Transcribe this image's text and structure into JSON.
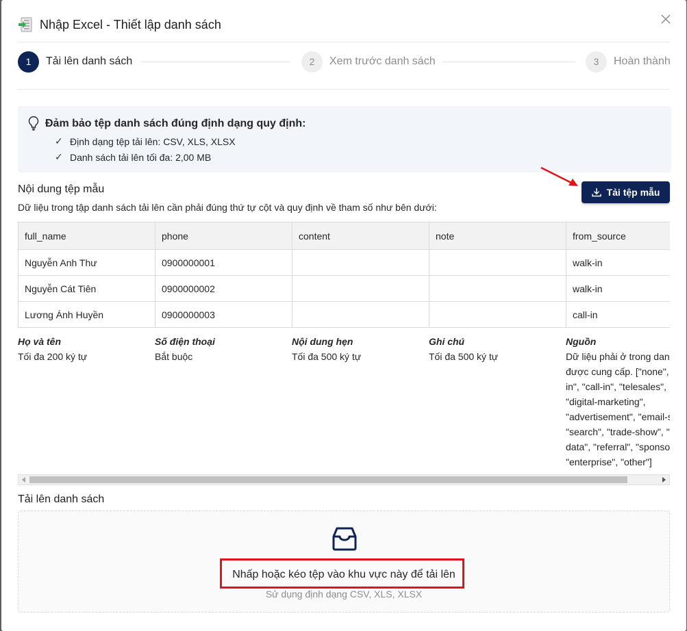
{
  "dialog": {
    "title": "Nhập Excel - Thiết lập danh sách",
    "close_icon": "close-icon",
    "title_icon": "excel-import-icon"
  },
  "steps": [
    {
      "number": "1",
      "label": "Tải lên danh sách",
      "state": "active"
    },
    {
      "number": "2",
      "label": "Xem trước danh sách",
      "state": "inactive"
    },
    {
      "number": "3",
      "label": "Hoàn thành",
      "state": "inactive"
    }
  ],
  "notice": {
    "icon": "lightbulb-icon",
    "title": "Đảm bảo tệp danh sách đúng định dạng quy định:",
    "items": [
      "Định dạng tệp tải lên:  CSV, XLS, XLSX",
      "Danh sách tải lên tối đa:  2,00 MB"
    ]
  },
  "template": {
    "title": "Nội dung tệp mẫu",
    "description": "Dữ liệu trong tập danh sách tải lên cần phải đúng thứ tự cột và quy định về tham số như bên dưới:",
    "download_label": "Tải tệp mẫu",
    "columns": [
      "full_name",
      "phone",
      "content",
      "note",
      "from_source"
    ],
    "rows": [
      [
        "Nguyễn Anh Thư",
        "0900000001",
        "",
        "",
        "walk-in"
      ],
      [
        "Nguyễn Cát Tiên",
        "0900000002",
        "",
        "",
        "walk-in"
      ],
      [
        "Lương Ánh Huyền",
        "0900000003",
        "",
        "",
        "call-in"
      ]
    ],
    "meta": [
      {
        "title": "Họ và tên",
        "lines": [
          "Tối đa 200 ký tự"
        ]
      },
      {
        "title": "Số điện thoại",
        "lines": [
          "Bắt buộc"
        ]
      },
      {
        "title": "Nội dung hẹn",
        "lines": [
          "Tối đa 500 ký tự"
        ]
      },
      {
        "title": "Ghi chú",
        "lines": [
          "Tối đa 500 ký tự"
        ]
      },
      {
        "title": "Nguồn",
        "lines": [
          "Dữ liệu phải ở trong dan",
          "được cung cấp. [\"none\",",
          "in\", \"call-in\", \"telesales\",",
          "\"digital-marketing\",",
          "\"advertisement\", \"email-s",
          "\"search\", \"trade-show\", \"",
          "data\", \"referral\", \"sponso",
          "\"enterprise\", \"other\"]"
        ]
      }
    ]
  },
  "upload": {
    "title": "Tải lên danh sách",
    "icon": "inbox-icon",
    "main_text": "Nhấp hoặc kéo tệp vào khu vực này để tải lên",
    "sub_text": "Sử dụng định dạng CSV, XLS, XLSX"
  },
  "colors": {
    "primary": "#0f2456",
    "annotation": "#e3131b",
    "notice_bg": "#f2f5fa"
  }
}
